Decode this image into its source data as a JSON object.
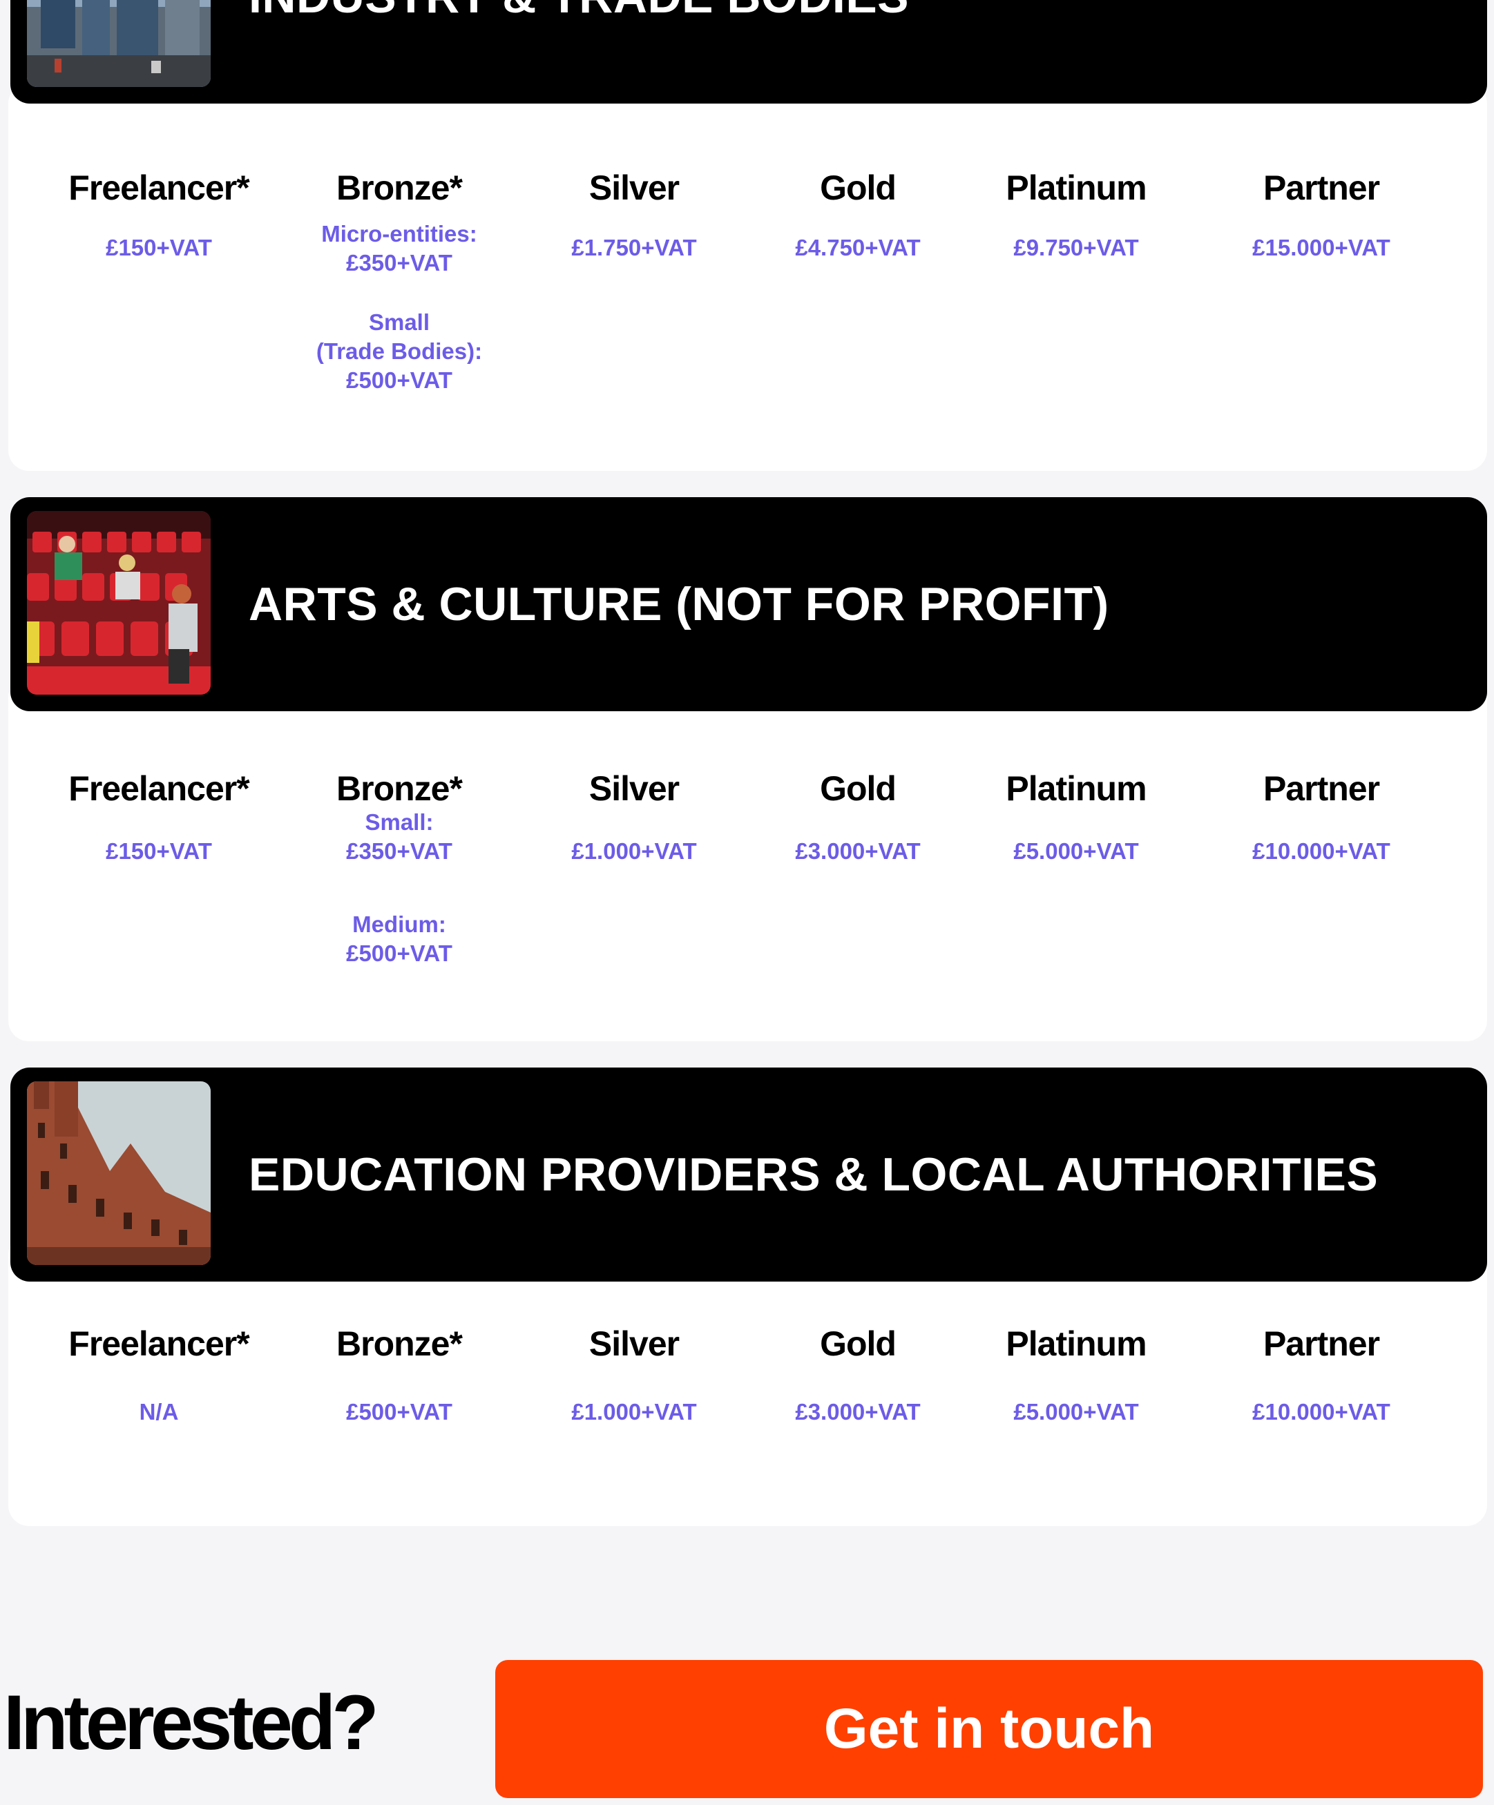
{
  "sections": [
    {
      "title": "INDUSTRY & TRADE BODIES",
      "tiers": [
        {
          "name": "Freelancer*",
          "prices": [
            "£150+VAT"
          ]
        },
        {
          "name": "Bronze*",
          "prices": [
            "Micro-entities:\n£350+VAT",
            "Small\n(Trade Bodies):\n£500+VAT"
          ]
        },
        {
          "name": "Silver",
          "prices": [
            "£1.750+VAT"
          ]
        },
        {
          "name": "Gold",
          "prices": [
            "£4.750+VAT"
          ]
        },
        {
          "name": "Platinum",
          "prices": [
            "£9.750+VAT"
          ]
        },
        {
          "name": "Partner",
          "prices": [
            "£15.000+VAT"
          ]
        }
      ]
    },
    {
      "title": "ARTS & CULTURE (NOT FOR PROFIT)",
      "tiers": [
        {
          "name": "Freelancer*",
          "prices": [
            "£150+VAT"
          ]
        },
        {
          "name": "Bronze*",
          "prices": [
            "Small:\n£350+VAT",
            "Medium:\n£500+VAT"
          ]
        },
        {
          "name": "Silver",
          "prices": [
            "£1.000+VAT"
          ]
        },
        {
          "name": "Gold",
          "prices": [
            "£3.000+VAT"
          ]
        },
        {
          "name": "Platinum",
          "prices": [
            "£5.000+VAT"
          ]
        },
        {
          "name": "Partner",
          "prices": [
            "£10.000+VAT"
          ]
        }
      ]
    },
    {
      "title": "EDUCATION PROVIDERS & LOCAL AUTHORITIES",
      "tiers": [
        {
          "name": "Freelancer*",
          "prices": [
            "N/A"
          ]
        },
        {
          "name": "Bronze*",
          "prices": [
            "£500+VAT"
          ]
        },
        {
          "name": "Silver",
          "prices": [
            "£1.000+VAT"
          ]
        },
        {
          "name": "Gold",
          "prices": [
            "£3.000+VAT"
          ]
        },
        {
          "name": "Platinum",
          "prices": [
            "£5.000+VAT"
          ]
        },
        {
          "name": "Partner",
          "prices": [
            "£10.000+VAT"
          ]
        }
      ]
    }
  ],
  "cta": {
    "title": "Interested?",
    "button_label": "Get in touch",
    "button_color": "#ff4000"
  },
  "colors": {
    "price": "#6c5ce7",
    "banner": "#000000",
    "page_background": "#f5f4f7"
  }
}
